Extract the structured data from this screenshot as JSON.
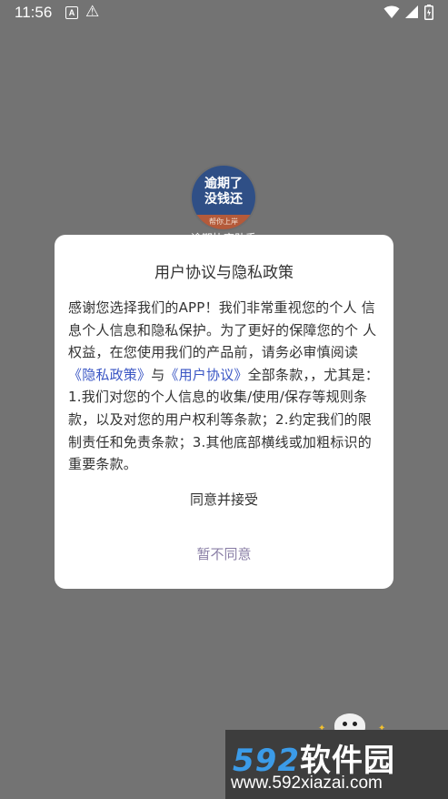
{
  "status_bar": {
    "time": "11:56",
    "left_icons": [
      "a-notification-icon",
      "warning-icon"
    ],
    "right_icons": [
      "wifi-icon",
      "signal-icon",
      "battery-icon"
    ]
  },
  "background_app": {
    "logo_line1": "逾期了",
    "logo_line2": "没钱还",
    "logo_strip": "帮你上岸",
    "app_name": "逾期协商助手"
  },
  "dialog": {
    "title": "用户协议与隐私政策",
    "body_intro": "感谢您选择我们的APP！我们非常重视您的个人 信息个人信息和隐私保护。为了更好的保障您的个 人权益，在您使用我们的产品前，请务必审慎阅读",
    "privacy_link": "《隐私政策》",
    "connector": "与",
    "user_link": "《用户协议》",
    "body_rest": "全部条款，，尤其是：1.我们对您的个人信息的收集/使用/保存等规则条款，以及对您的用户权利等条款；2.约定我们的限制责任和免责条款；3.其他底部横线或加粗标识的重要条款。",
    "agree_button": "同意并接受",
    "disagree_button": "暂不同意"
  },
  "watermark": {
    "brand_number": "592",
    "brand_text": "软件园",
    "url": "www.592xiazai.com"
  },
  "colors": {
    "overlay": "#737373",
    "link": "#3a56c4",
    "disagree": "#8a7fa6",
    "watermark_blue": "#3b9be8"
  }
}
